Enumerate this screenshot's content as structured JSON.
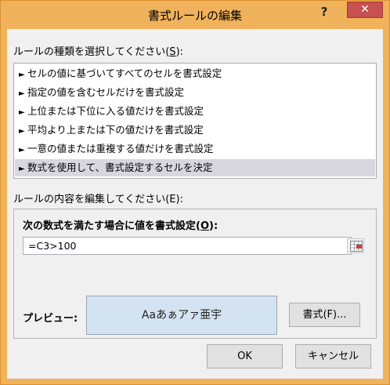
{
  "window": {
    "title": "書式ルールの編集",
    "help_label": "?",
    "close_label": "✕"
  },
  "rule_type_section": {
    "label_prefix": "ルールの種類を選択してください(",
    "label_key": "S",
    "label_suffix": "):",
    "items": [
      {
        "label": "セルの値に基づいてすべてのセルを書式設定",
        "selected": false
      },
      {
        "label": "指定の値を含むセルだけを書式設定",
        "selected": false
      },
      {
        "label": "上位または下位に入る値だけを書式設定",
        "selected": false
      },
      {
        "label": "平均より上または下の値だけを書式設定",
        "selected": false
      },
      {
        "label": "一意の値または重複する値だけを書式設定",
        "selected": false
      },
      {
        "label": "数式を使用して、書式設定するセルを決定",
        "selected": true
      }
    ]
  },
  "rule_desc_section": {
    "label": "ルールの内容を編集してください(E):",
    "formula_label_prefix": "次の数式を満たす場合に値を書式設定(",
    "formula_label_key": "O",
    "formula_label_suffix": "):",
    "formula_value": "=C3>100"
  },
  "preview": {
    "label": "プレビュー:",
    "sample_text": "Aaあぁアァ亜宇"
  },
  "buttons": {
    "format": "書式(F)...",
    "ok": "OK",
    "cancel": "キャンセル"
  },
  "icons": {
    "list_arrow": "►",
    "range_picker": "collapse-dialog-icon"
  },
  "colors": {
    "title_bar": "#f0b25a",
    "close_button": "#c75050",
    "selected_item": "#d8d6de",
    "preview_bg": "#d4e3f2"
  }
}
